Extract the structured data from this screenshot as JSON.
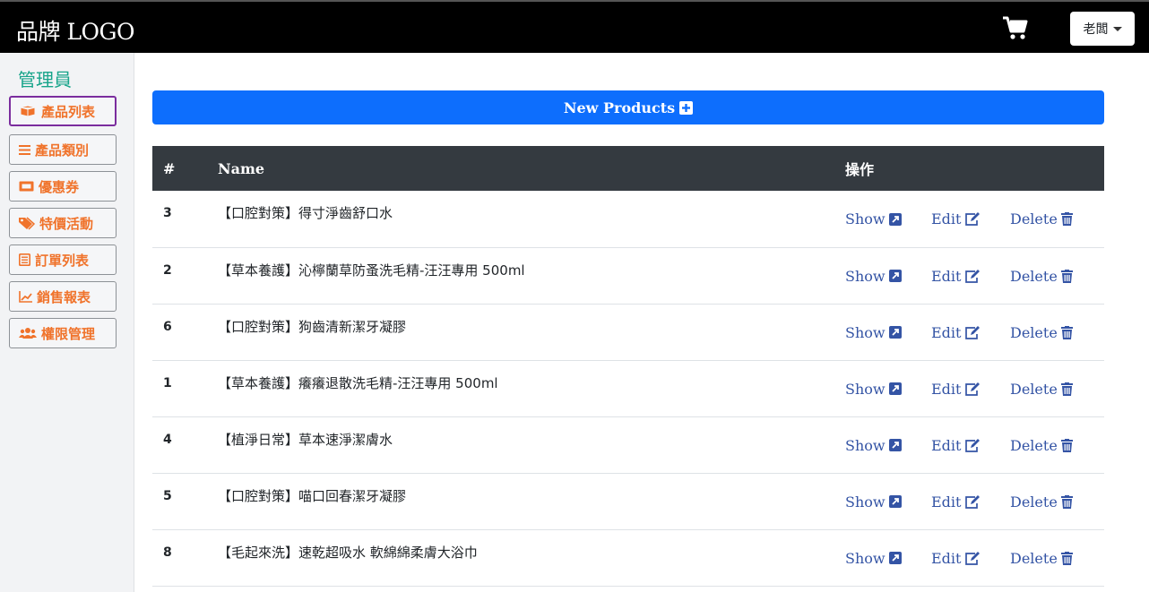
{
  "navbar": {
    "brand": "品牌 LOGO",
    "user_label": "老闆"
  },
  "sidebar": {
    "title": "管理員",
    "items": [
      {
        "label": "產品列表",
        "icon": "box-icon"
      },
      {
        "label": "產品類別",
        "icon": "list-icon"
      },
      {
        "label": "優惠券",
        "icon": "ticket-icon"
      },
      {
        "label": "特價活動",
        "icon": "tags-icon"
      },
      {
        "label": "訂單列表",
        "icon": "receipt-icon"
      },
      {
        "label": "銷售報表",
        "icon": "chart-icon"
      },
      {
        "label": "權限管理",
        "icon": "users-icon"
      }
    ]
  },
  "main": {
    "new_button": "New Products",
    "columns": {
      "num": "#",
      "name": "Name",
      "actions": "操作"
    },
    "actions": {
      "show": "Show",
      "edit": "Edit",
      "delete": "Delete"
    },
    "rows": [
      {
        "id": "3",
        "name": "【口腔對策】得寸淨齒舒口水"
      },
      {
        "id": "2",
        "name": "【草本養護】沁檸蘭草防蚤洗毛精-汪汪專用 500ml"
      },
      {
        "id": "6",
        "name": "【口腔對策】狗齒清新潔牙凝膠"
      },
      {
        "id": "1",
        "name": "【草本養護】癢癢退散洗毛精-汪汪專用 500ml"
      },
      {
        "id": "4",
        "name": "【植淨日常】草本速淨潔膚水"
      },
      {
        "id": "5",
        "name": "【口腔對策】喵口回春潔牙凝膠"
      },
      {
        "id": "8",
        "name": "【毛起來洗】速乾超吸水 軟綿綿柔膚大浴巾"
      }
    ]
  },
  "colors": {
    "accent": "#0d6efd",
    "sidebar_text": "#f0732b",
    "title": "#17a48a",
    "link": "#3454a5",
    "header_bg": "#343a40"
  }
}
